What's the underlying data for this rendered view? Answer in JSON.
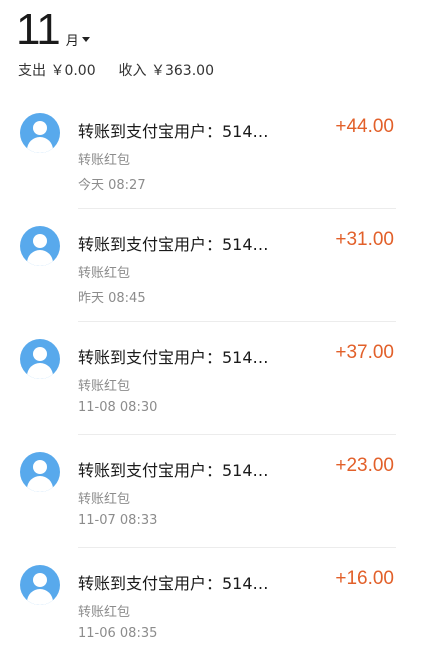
{
  "header": {
    "month_number": "11",
    "month_unit": "月",
    "expense_label": "支出",
    "expense_value": "￥0.00",
    "income_label": "收入",
    "income_value": "￥363.00"
  },
  "transactions": [
    {
      "title": "转账到支付宝用户：514…",
      "subtitle": "转账红包",
      "time": "今天  08:27",
      "amount": "+44.00"
    },
    {
      "title": "转账到支付宝用户：514…",
      "subtitle": "转账红包",
      "time": "昨天  08:45",
      "amount": "+31.00"
    },
    {
      "title": "转账到支付宝用户：514…",
      "subtitle": "转账红包",
      "time": "11-08  08:30",
      "amount": "+37.00"
    },
    {
      "title": "转账到支付宝用户：514…",
      "subtitle": "转账红包",
      "time": "11-07  08:33",
      "amount": "+23.00"
    },
    {
      "title": "转账到支付宝用户：514…",
      "subtitle": "转账红包",
      "time": "11-06  08:35",
      "amount": "+16.00"
    }
  ],
  "colors": {
    "amount": "#e2602a",
    "avatar": "#58a9ec",
    "muted_text": "#8c8c8c"
  },
  "icons": {
    "month_dropdown": "caret-down-icon",
    "row_avatar": "user-avatar-icon"
  }
}
